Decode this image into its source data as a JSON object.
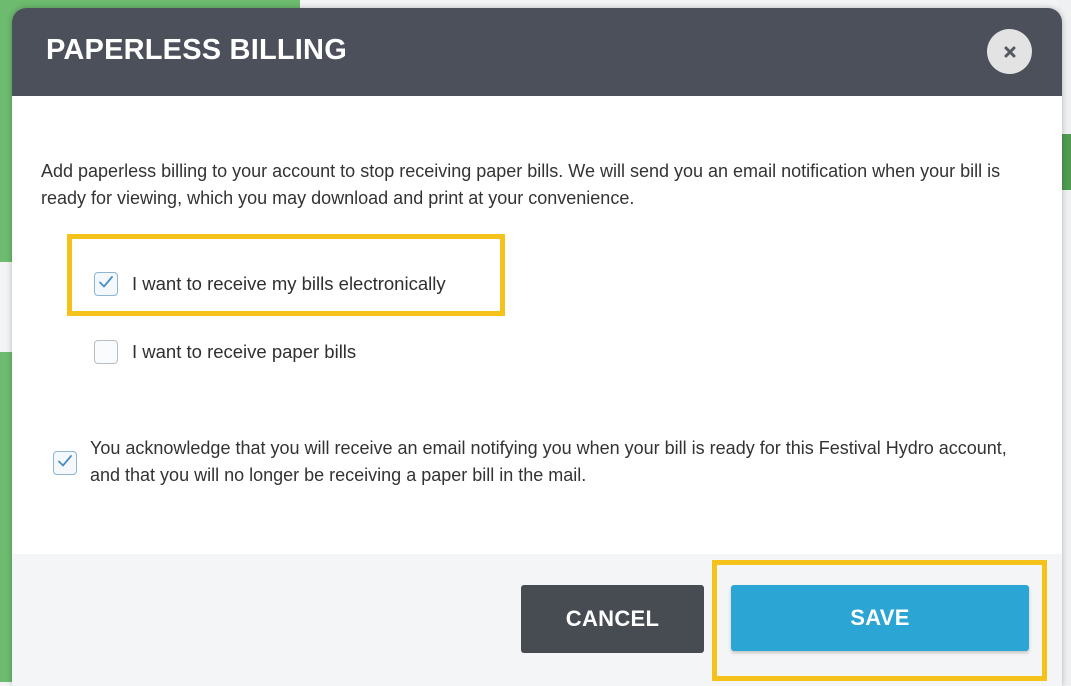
{
  "modal": {
    "title": "PAPERLESS BILLING",
    "close_icon": "close-icon"
  },
  "body": {
    "description": "Add paperless billing to your account to stop receiving paper bills. We will send you an email notification when your bill is ready for viewing, which you may download and print at your convenience.",
    "options": [
      {
        "label": "I want to receive my bills electronically",
        "checked": true,
        "highlighted": true
      },
      {
        "label": "I want to receive paper bills",
        "checked": false,
        "highlighted": false
      }
    ],
    "acknowledgement": {
      "text": "You acknowledge that you will receive an email notifying you when your bill is ready for this Festival Hydro account, and that you will no longer be receiving a paper bill in the mail.",
      "checked": true
    }
  },
  "footer": {
    "cancel_label": "CANCEL",
    "save_label": "SAVE",
    "save_highlighted": true
  },
  "colors": {
    "header_bg": "#4b505a",
    "save_button": "#2aa5d4",
    "cancel_button": "#474b52",
    "highlight": "#f5c11b",
    "background_green": "#6cbb6e"
  }
}
